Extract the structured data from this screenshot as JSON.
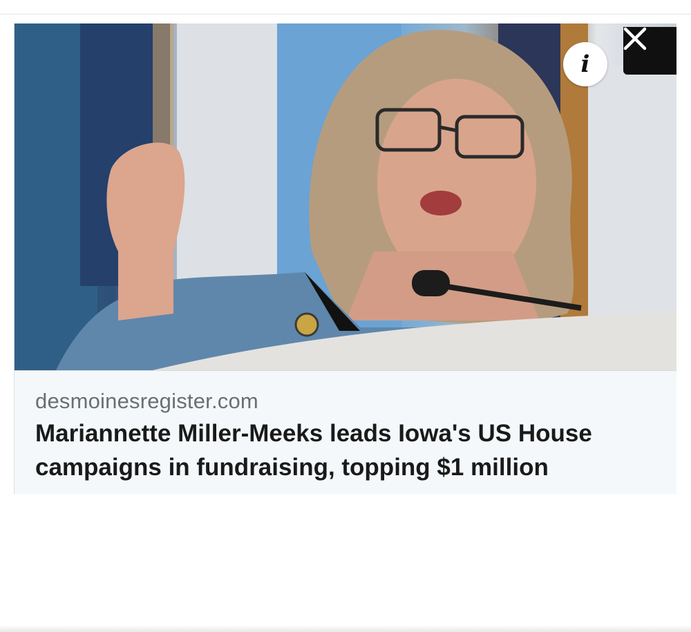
{
  "card": {
    "image_alt": "Woman with glasses speaking at a podium microphone in front of flags",
    "info_button_label": "i",
    "close_button_label": "close",
    "source": "desmoinesregister.com",
    "headline": "Mariannette Miller-Meeks leads Iowa's US House campaigns in fundraising, topping $1 million"
  },
  "icons": {
    "info": "info-icon",
    "close": "close-icon"
  },
  "colors": {
    "caption_background": "#f4f8fa",
    "source_text": "#6a6f73",
    "headline_text": "#1a1a1a",
    "close_background": "#101010"
  }
}
